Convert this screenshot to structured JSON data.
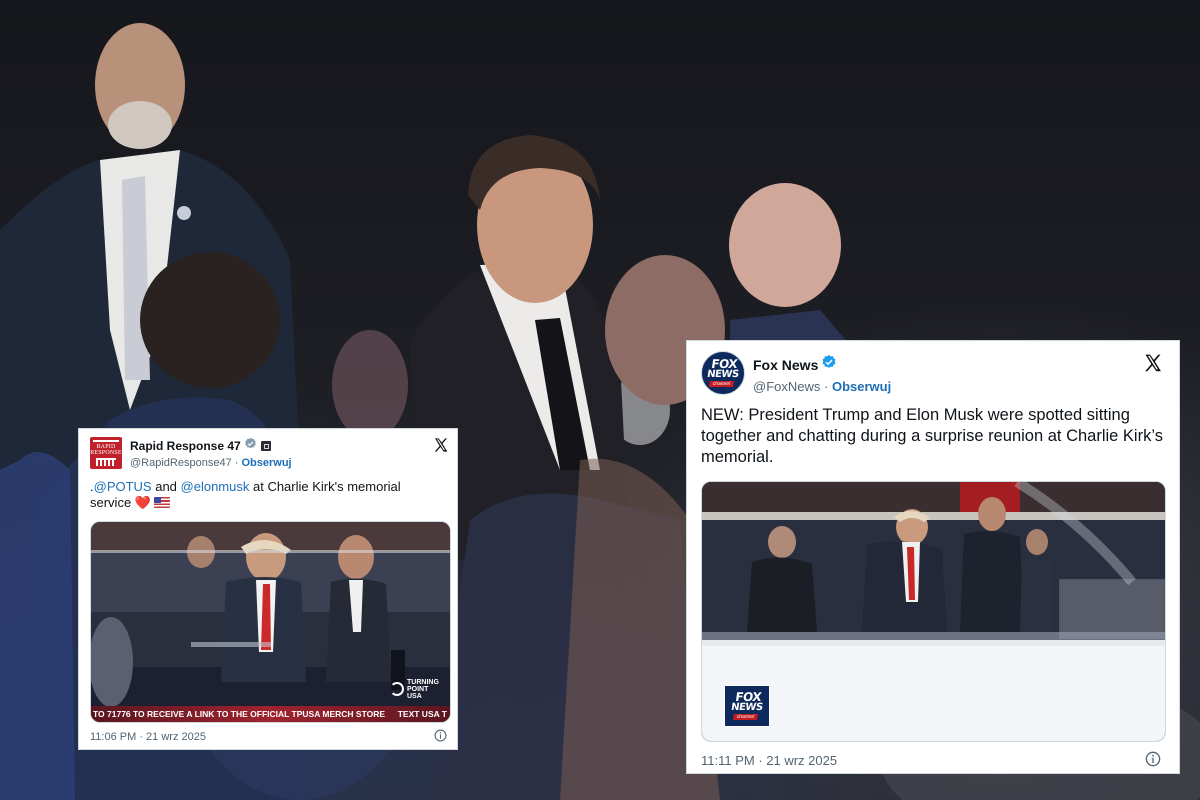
{
  "left_tweet": {
    "display_name": "Rapid Response 47",
    "handle": "@RapidResponse47",
    "follow_label": "Obserwuj",
    "avatar_text": "RAPID RESPONSE",
    "text_prefix": ".",
    "mention_1": "@POTUS",
    "and_word": " and ",
    "mention_2": "@elonmusk",
    "text_suffix": " at Charlie Kirk's memorial service ",
    "heart": "❤️",
    "ticker_left": "TO 71776 TO RECEIVE A LINK TO THE OFFICIAL TPUSA MERCH STORE",
    "ticker_right": "TEXT USA T",
    "watermark": "TURNING POINT USA",
    "timestamp": "11:06 PM · 21 wrz 2025",
    "icons": [
      "verified-icon",
      "affiliate-badge-icon",
      "x-logo-icon",
      "info-icon"
    ]
  },
  "right_tweet": {
    "display_name": "Fox News",
    "handle": "@FoxNews",
    "follow_label": "Obserwuj",
    "avatar_line1": "FOX",
    "avatar_line2": "NEWS",
    "avatar_line3": "channel",
    "text": "NEW: President Trump and Elon Musk were spotted sitting together and chatting during a surprise reunion at Charlie Kirk’s memorial.",
    "watermark_line1": "FOX",
    "watermark_line2": "NEWS",
    "watermark_line3": "channel",
    "timestamp": "11:11 PM · 21 wrz 2025",
    "icons": [
      "verified-icon",
      "x-logo-icon",
      "info-icon"
    ]
  },
  "colors": {
    "link_blue": "#1d6fb8",
    "verified_blue": "#1d9bf0",
    "muted_text": "#536471",
    "rapid_response_red": "#c0222d",
    "fox_navy": "#0e2a5c"
  }
}
